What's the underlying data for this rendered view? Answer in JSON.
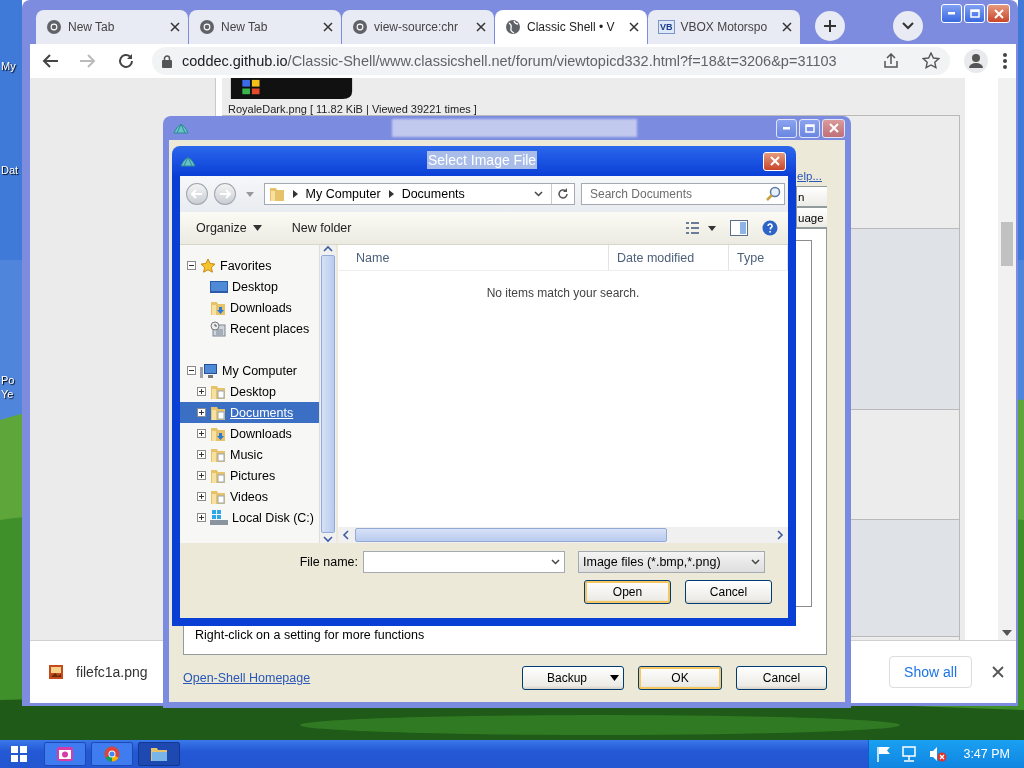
{
  "desktop": {
    "icon_labels": [
      "My",
      "Dat",
      "Po",
      "Ye"
    ]
  },
  "browser": {
    "tabs": [
      {
        "title": "New Tab",
        "kind": "browser",
        "selected": false
      },
      {
        "title": "New Tab",
        "kind": "browser",
        "selected": false
      },
      {
        "title": "view-source:chr",
        "kind": "browser",
        "selected": false
      },
      {
        "title": "Classic Shell • V",
        "kind": "globe",
        "selected": true
      },
      {
        "title": "VBOX Motorspo",
        "kind": "badge",
        "badge": "VB",
        "selected": false
      }
    ],
    "address": {
      "domain": "coddec.github.io",
      "path": "/Classic-Shell/www.classicshell.net/forum/viewtopicd332.html?f=18&t=3206&p=31103"
    },
    "page": {
      "image_caption": "RoyaleDark.png [ 11.82 KiB | Viewed 39221 times ]"
    },
    "download_bar": {
      "file": "filefc1a.png",
      "button": "Show all"
    }
  },
  "settings_window": {
    "help_link": "elp...",
    "tabs": [
      "n",
      "uage"
    ],
    "hint": "Right-click on a setting for more functions",
    "homepage_link": "Open-Shell Homepage",
    "buttons": [
      {
        "label": "Backup",
        "kind": "dropdown"
      },
      {
        "label": "OK",
        "kind": "default"
      },
      {
        "label": "Cancel",
        "kind": "plain"
      }
    ]
  },
  "file_dialog": {
    "title": "Select Image File",
    "breadcrumb": [
      "My Computer",
      "Documents"
    ],
    "search": {
      "placeholder": "Search Documents"
    },
    "toolbar": [
      {
        "label": "Organize",
        "kind": "menu"
      },
      {
        "label": "New folder",
        "kind": "plain"
      }
    ],
    "tree": [
      {
        "label": "Favorites",
        "kind": "star",
        "expanded": true,
        "selected": false,
        "children": [
          {
            "label": "Desktop",
            "kind": "desktop",
            "selected": false
          },
          {
            "label": "Downloads",
            "kind": "downloads",
            "selected": false
          },
          {
            "label": "Recent places",
            "kind": "recent",
            "selected": false
          }
        ]
      },
      {
        "label": "My Computer",
        "kind": "computer",
        "expanded": true,
        "selected": false,
        "children": [
          {
            "label": "Desktop",
            "kind": "folder",
            "expanded": false,
            "selected": false
          },
          {
            "label": "Documents",
            "kind": "folder",
            "expanded": false,
            "selected": true
          },
          {
            "label": "Downloads",
            "kind": "downloads",
            "expanded": false,
            "selected": false
          },
          {
            "label": "Music",
            "kind": "folder",
            "expanded": false,
            "selected": false
          },
          {
            "label": "Pictures",
            "kind": "folder",
            "expanded": false,
            "selected": false
          },
          {
            "label": "Videos",
            "kind": "folder",
            "expanded": false,
            "selected": false
          },
          {
            "label": "Local Disk (C:)",
            "kind": "disk",
            "expanded": false,
            "selected": false
          }
        ]
      }
    ],
    "columns": [
      "Name",
      "Date modified",
      "Type"
    ],
    "empty_message": "No items match your search.",
    "file_name_label": "File name:",
    "filter": "Image files (*.bmp,*.png)",
    "buttons": [
      {
        "label": "Open",
        "kind": "default"
      },
      {
        "label": "Cancel",
        "kind": "plain"
      }
    ]
  },
  "taskbar": {
    "apps": [
      {
        "kind": "camera",
        "selected": false
      },
      {
        "kind": "browser",
        "selected": false
      },
      {
        "kind": "folder",
        "selected": true
      }
    ],
    "clock": "3:47 PM"
  }
}
